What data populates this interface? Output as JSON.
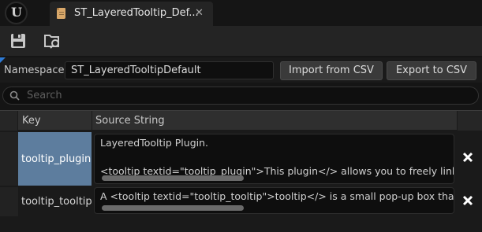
{
  "tab": {
    "title": "ST_LayeredTooltip_Def...",
    "close_glyph": "✕"
  },
  "toolbar": {
    "save_icon": "save-icon",
    "browse_icon": "browse-icon"
  },
  "namespace": {
    "label": "Namespace:",
    "value": "ST_LayeredTooltipDefault",
    "import_label": "Import from CSV",
    "export_label": "Export to CSV"
  },
  "search": {
    "placeholder": "Search"
  },
  "table": {
    "headers": {
      "key": "Key",
      "source": "Source String"
    },
    "rows": [
      {
        "key": "tooltip_plugin",
        "line1": "LayeredTooltip Plugin.",
        "line2": "",
        "line3": "<tooltip textid=\"tooltip_plugin\">This plugin</> allows you to freely link another",
        "selected": true
      },
      {
        "key": "tooltip_tooltip",
        "line1": "A <tooltip textid=\"tooltip_tooltip\">tooltip</> is a small pop-up box that appears",
        "selected": false
      }
    ],
    "delete_glyph": "✖"
  },
  "colors": {
    "accent": "#2e7bd6",
    "selection": "#5d7d9e",
    "background": "#151515"
  }
}
